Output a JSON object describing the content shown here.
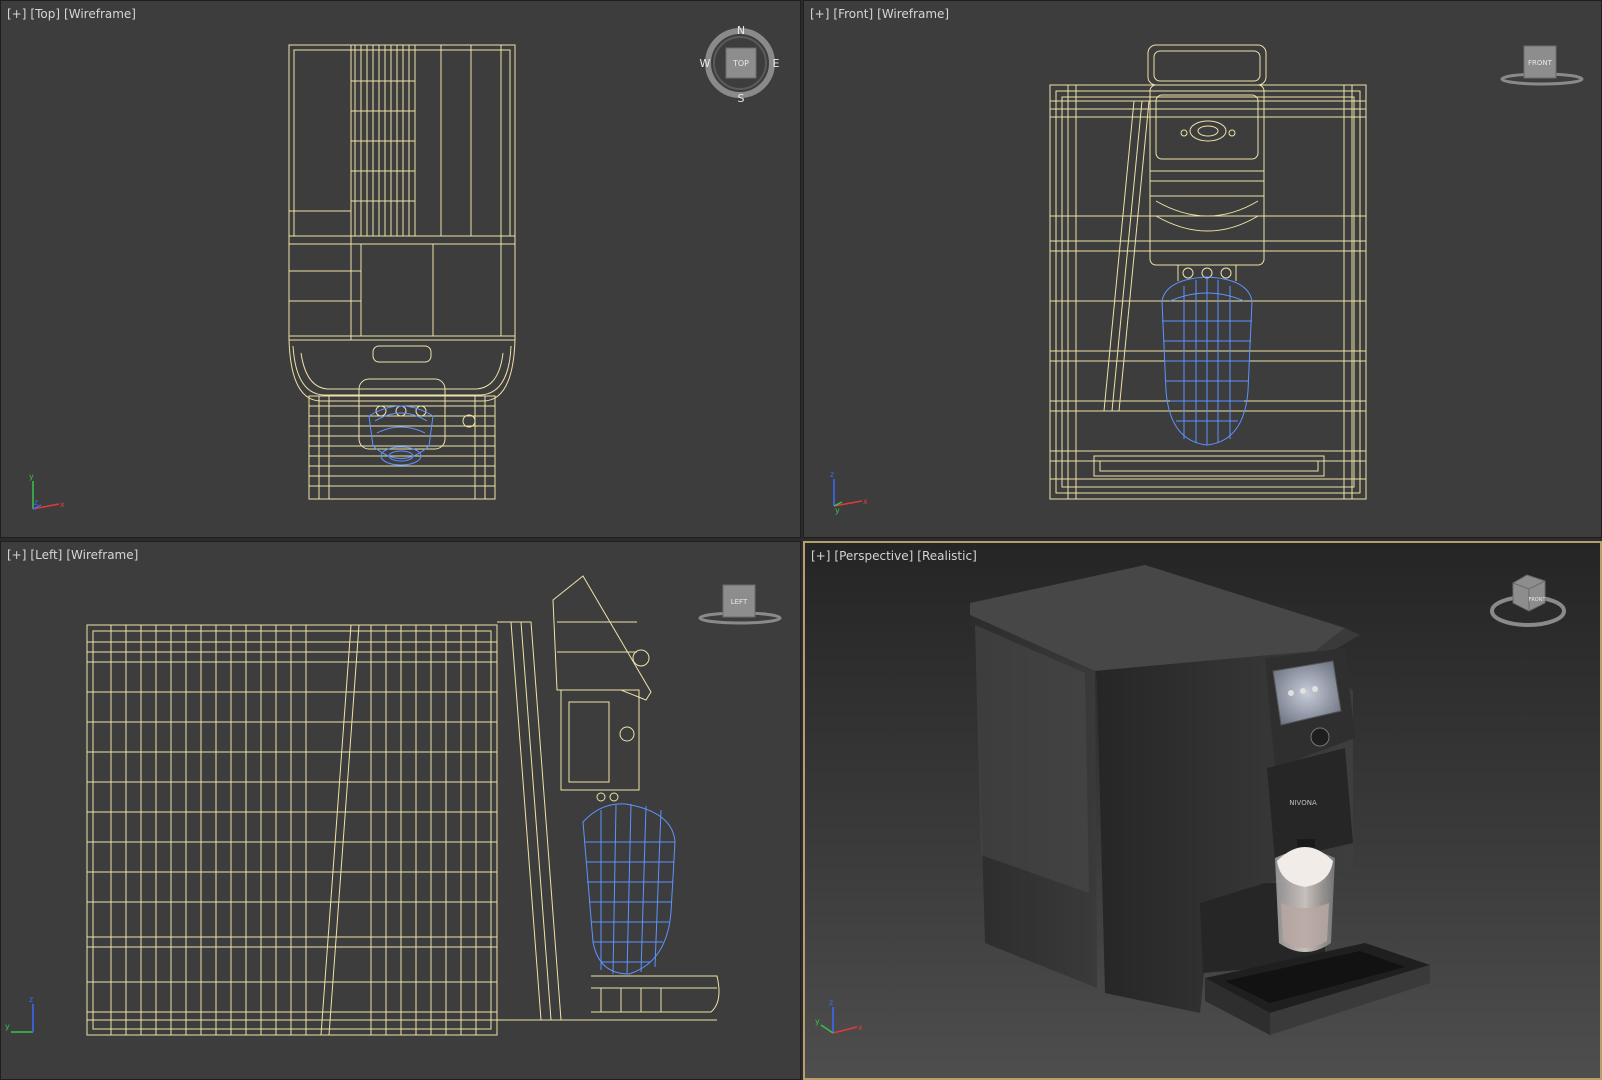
{
  "viewports": {
    "top": {
      "label_plus": "[+]",
      "label_view": "[Top]",
      "label_shading": "[Wireframe]",
      "viewcube_face": "TOP",
      "compass": {
        "n": "N",
        "s": "S",
        "e": "E",
        "w": "W"
      },
      "axis": {
        "a": "y",
        "b": "x",
        "c": "z"
      }
    },
    "front": {
      "label_plus": "[+]",
      "label_view": "[Front]",
      "label_shading": "[Wireframe]",
      "viewcube_face": "FRONT",
      "axis": {
        "a": "z",
        "b": "x",
        "c": "y"
      }
    },
    "left": {
      "label_plus": "[+]",
      "label_view": "[Left]",
      "label_shading": "[Wireframe]",
      "viewcube_face": "LEFT",
      "axis": {
        "a": "z",
        "b": "y"
      }
    },
    "perspective": {
      "label_plus": "[+]",
      "label_view": "[Perspective]",
      "label_shading": "[Realistic]",
      "viewcube_face": "FRONT",
      "brand_text": "NIVONA",
      "axis": {
        "a": "z",
        "b": "x",
        "c": "y"
      }
    }
  },
  "colors": {
    "wireframe": "#efe2a8",
    "selected_mesh": "#5d93ff",
    "active_border": "#b6a06a",
    "axis_x": "#e03a3a",
    "axis_y": "#37c44a",
    "axis_z": "#3b6bff"
  }
}
